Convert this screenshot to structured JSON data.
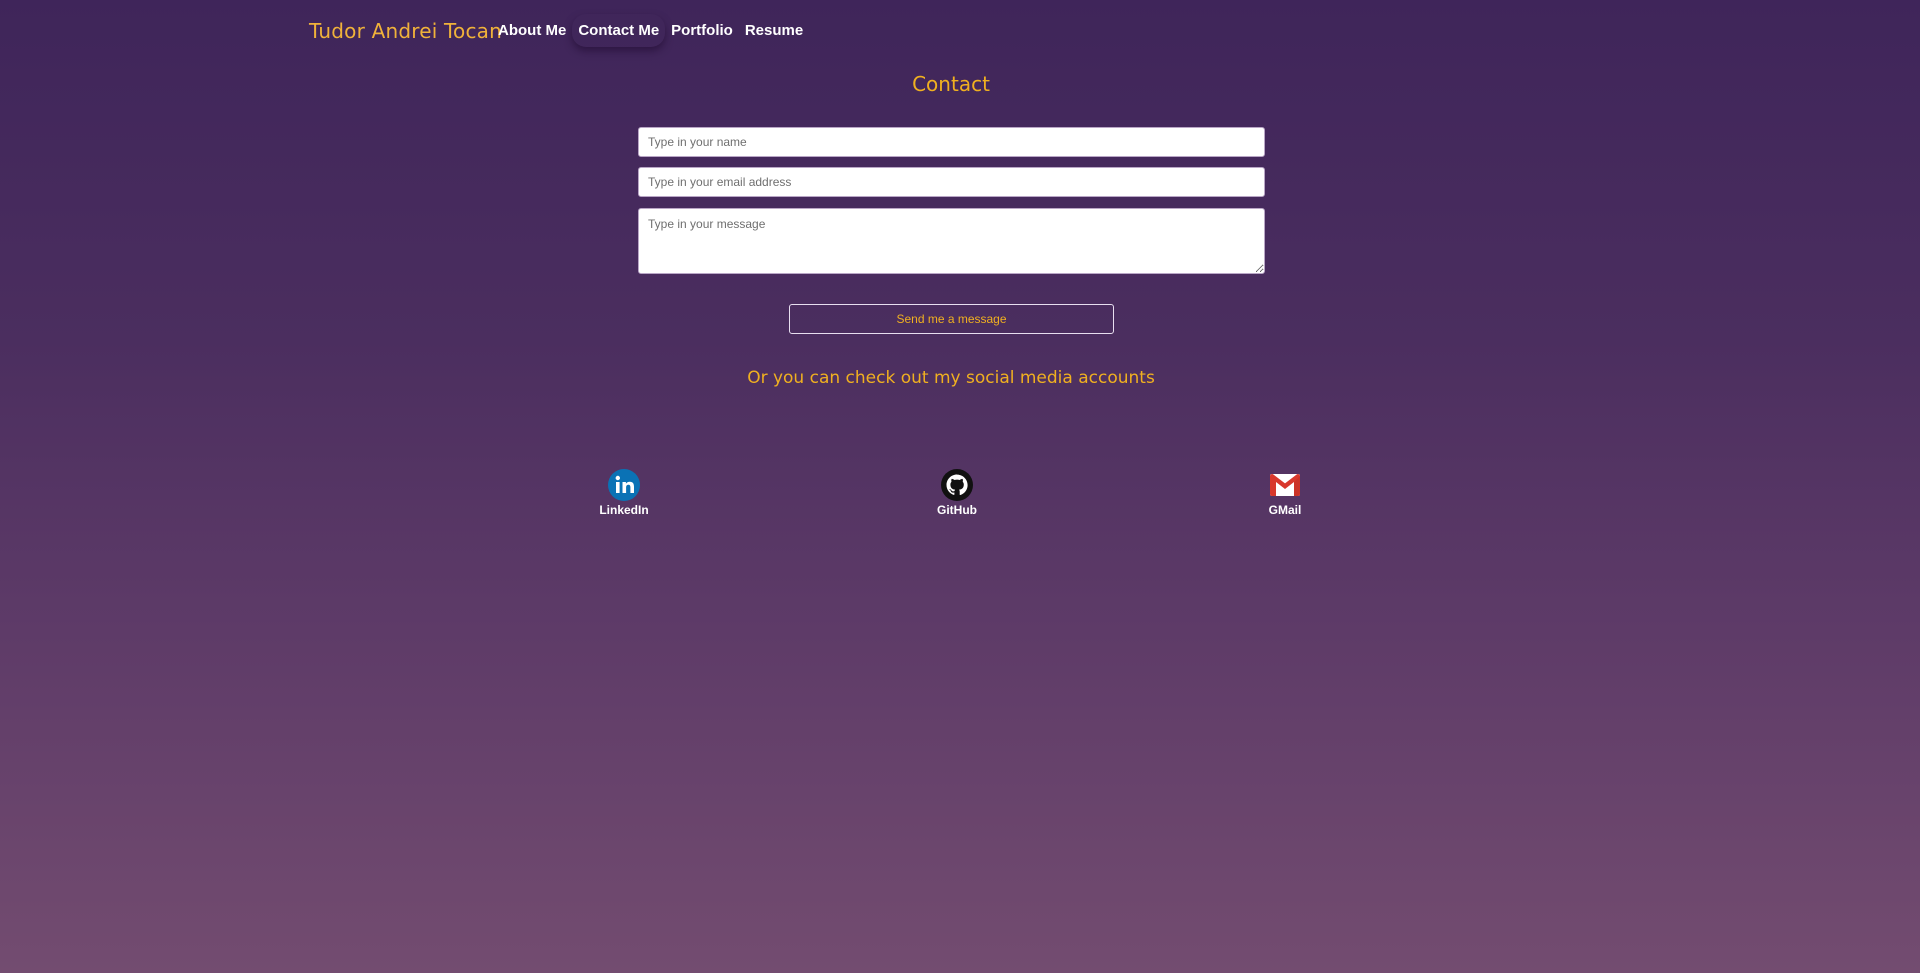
{
  "nav": {
    "brand": "Tudor Andrei Tocan",
    "links": [
      {
        "label": "About Me"
      },
      {
        "label": "Contact Me"
      },
      {
        "label": "Portfolio"
      },
      {
        "label": "Resume"
      }
    ],
    "active_index": 1
  },
  "contact": {
    "title": "Contact",
    "name_placeholder": "Type in your name",
    "email_placeholder": "Type in your email address",
    "message_placeholder": "Type in your message",
    "name_value": "",
    "email_value": "",
    "message_value": "",
    "send_label": "Send me a message"
  },
  "social": {
    "heading": "Or you can check out my social media accounts",
    "accounts": [
      {
        "label": "LinkedIn",
        "icon": "linkedin-icon"
      },
      {
        "label": "GitHub",
        "icon": "github-icon"
      },
      {
        "label": "GMail",
        "icon": "gmail-icon"
      }
    ]
  },
  "colors": {
    "accent": "#f0b020",
    "background_top": "#3f255a",
    "background_bottom": "#734c70",
    "text": "#ffffff",
    "linkedin_blue": "#0a72b5"
  }
}
